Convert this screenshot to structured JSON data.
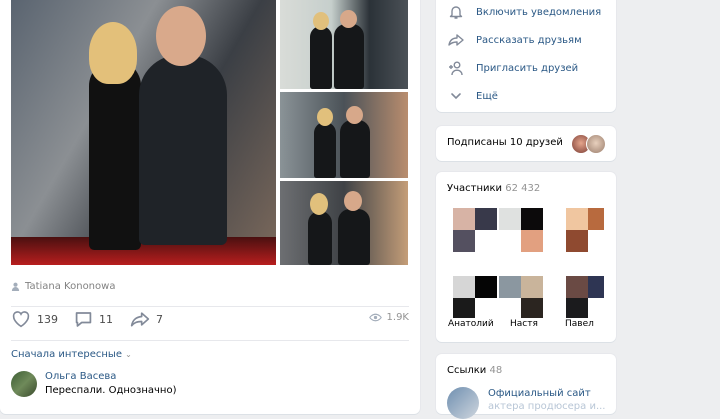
{
  "post": {
    "author_credit": "Tatiana Kononowa",
    "likes": "139",
    "comments": "11",
    "shares": "7",
    "views": "1.9K",
    "sort_label": "Сначала интересные",
    "comment": {
      "author": "Ольга Васева",
      "text": "Переспали. Однозначно)"
    }
  },
  "menu": {
    "items": [
      {
        "label": "Включить уведомления",
        "icon": "bell-icon"
      },
      {
        "label": "Рассказать друзьям",
        "icon": "share-arrow-icon"
      },
      {
        "label": "Пригласить друзей",
        "icon": "add-user-icon"
      },
      {
        "label": "Ещё",
        "icon": "chevron-down-icon"
      }
    ]
  },
  "friends": {
    "label": "Подписаны 10 друзей"
  },
  "members": {
    "title": "Участники",
    "count": "62 432",
    "names": [
      "Анатолий",
      "Настя",
      "Павел"
    ]
  },
  "links": {
    "title": "Ссылки",
    "count": "48",
    "first_line": "Официальный сайт",
    "second_line": "актера продюсера и..."
  },
  "colors": {
    "link_blue": "#2a5885",
    "muted": "#828a99",
    "background": "#edeef0"
  }
}
